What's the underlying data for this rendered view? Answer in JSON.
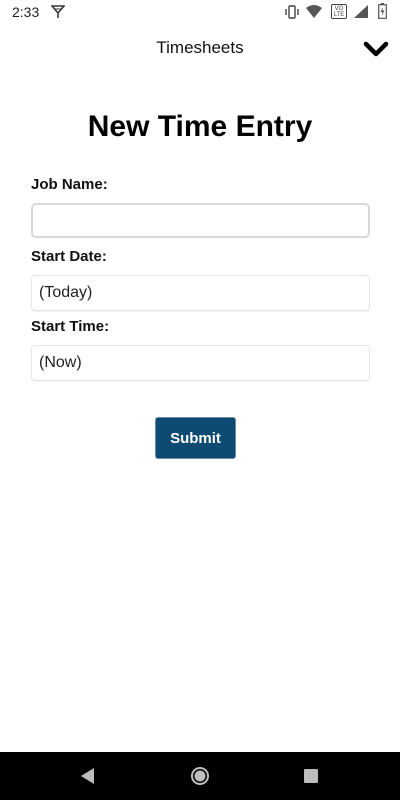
{
  "status_bar": {
    "time": "2:33",
    "icons": [
      "wifi-calling-icon",
      "vibrate-icon",
      "wifi-icon",
      "volte-icon",
      "cell-signal-icon",
      "battery-icon"
    ],
    "volte_label": "VO LTE"
  },
  "header": {
    "title": "Timesheets",
    "menu_icon": "chevron-down-icon"
  },
  "form": {
    "heading": "New Time Entry",
    "job_name": {
      "label": "Job Name:",
      "value": ""
    },
    "start_date": {
      "label": "Start Date:",
      "value": "(Today)"
    },
    "start_time": {
      "label": "Start Time:",
      "value": "(Now)"
    },
    "submit_label": "Submit"
  },
  "nav_bar": {
    "buttons": [
      "back-icon",
      "home-icon",
      "recents-icon"
    ]
  },
  "colors": {
    "submit_bg": "#0d4b73",
    "nav_bg": "#000000",
    "background": "#ffffff"
  }
}
